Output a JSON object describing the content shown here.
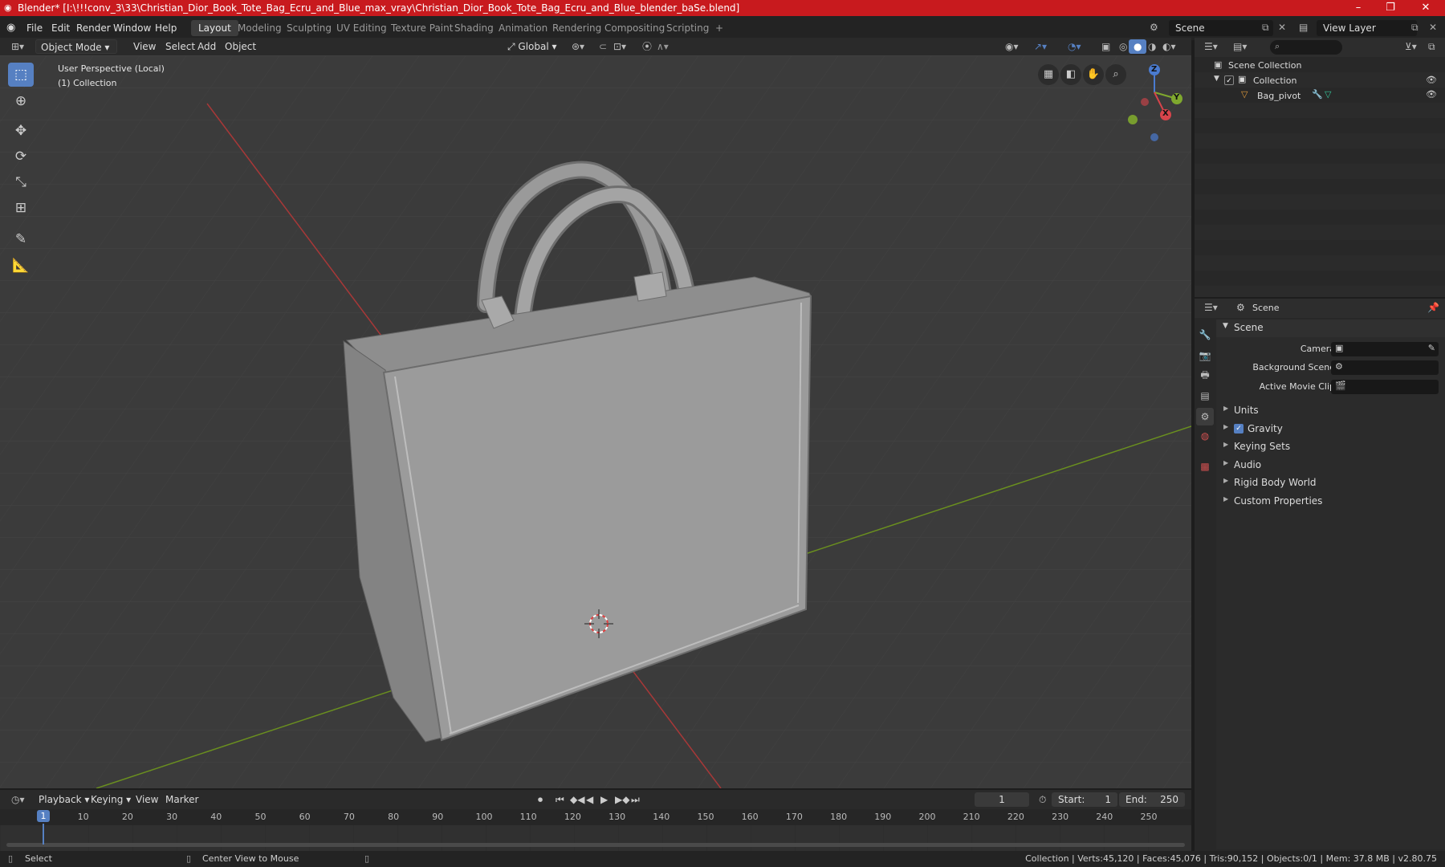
{
  "window": {
    "title": "Blender* [I:\\!!!conv_3\\33\\Christian_Dior_Book_Tote_Bag_Ecru_and_Blue_max_vray\\Christian_Dior_Book_Tote_Bag_Ecru_and_Blue_blender_baSe.blend]",
    "minimize": "–",
    "maximize": "❐",
    "close": "✕"
  },
  "menubar": {
    "file": "File",
    "edit": "Edit",
    "render": "Render",
    "window": "Window",
    "help": "Help",
    "workspaces": [
      "Layout",
      "Modeling",
      "Sculpting",
      "UV Editing",
      "Texture Paint",
      "Shading",
      "Animation",
      "Rendering",
      "Compositing",
      "Scripting"
    ],
    "add_workspace": "+",
    "scene_name": "Scene",
    "view_layer": "View Layer"
  },
  "viewport_header": {
    "mode": "Object Mode",
    "view": "View",
    "select": "Select",
    "add": "Add",
    "object": "Object",
    "orientation": "Global"
  },
  "viewport": {
    "perspective_label": "User Perspective (Local)",
    "collection_label": "(1) Collection",
    "gizmo": {
      "z": "Z",
      "y": "Y",
      "x": "X"
    }
  },
  "outliner": {
    "root": "Scene Collection",
    "collection": "Collection",
    "object": "Bag_pivot"
  },
  "properties": {
    "header": "Scene",
    "panel": "Scene",
    "camera_label": "Camera",
    "background_scene_label": "Background Scene",
    "active_movie_clip_label": "Active Movie Clip",
    "sections": [
      "Units",
      "Gravity",
      "Keying Sets",
      "Audio",
      "Rigid Body World",
      "Custom Properties"
    ]
  },
  "timeline": {
    "playback": "Playback",
    "keying": "Keying",
    "view": "View",
    "marker": "Marker",
    "current_frame": "1",
    "start_label": "Start:",
    "start": "1",
    "end_label": "End:",
    "end": "250",
    "ticks": [
      "1",
      "10",
      "20",
      "30",
      "40",
      "50",
      "60",
      "70",
      "80",
      "90",
      "100",
      "110",
      "120",
      "130",
      "140",
      "150",
      "160",
      "170",
      "180",
      "190",
      "200",
      "210",
      "220",
      "230",
      "240",
      "250"
    ]
  },
  "statusbar": {
    "select": "Select",
    "center": "Center View to Mouse",
    "stats": "Collection | Verts:45,120 | Faces:45,076 | Tris:90,152 | Objects:0/1 | Mem: 37.8 MB | v2.80.75"
  },
  "colors": {
    "accent": "#5680c2",
    "titlebar": "#c81a1e",
    "x_axis": "#a83838",
    "y_axis": "#6a8f1f"
  }
}
